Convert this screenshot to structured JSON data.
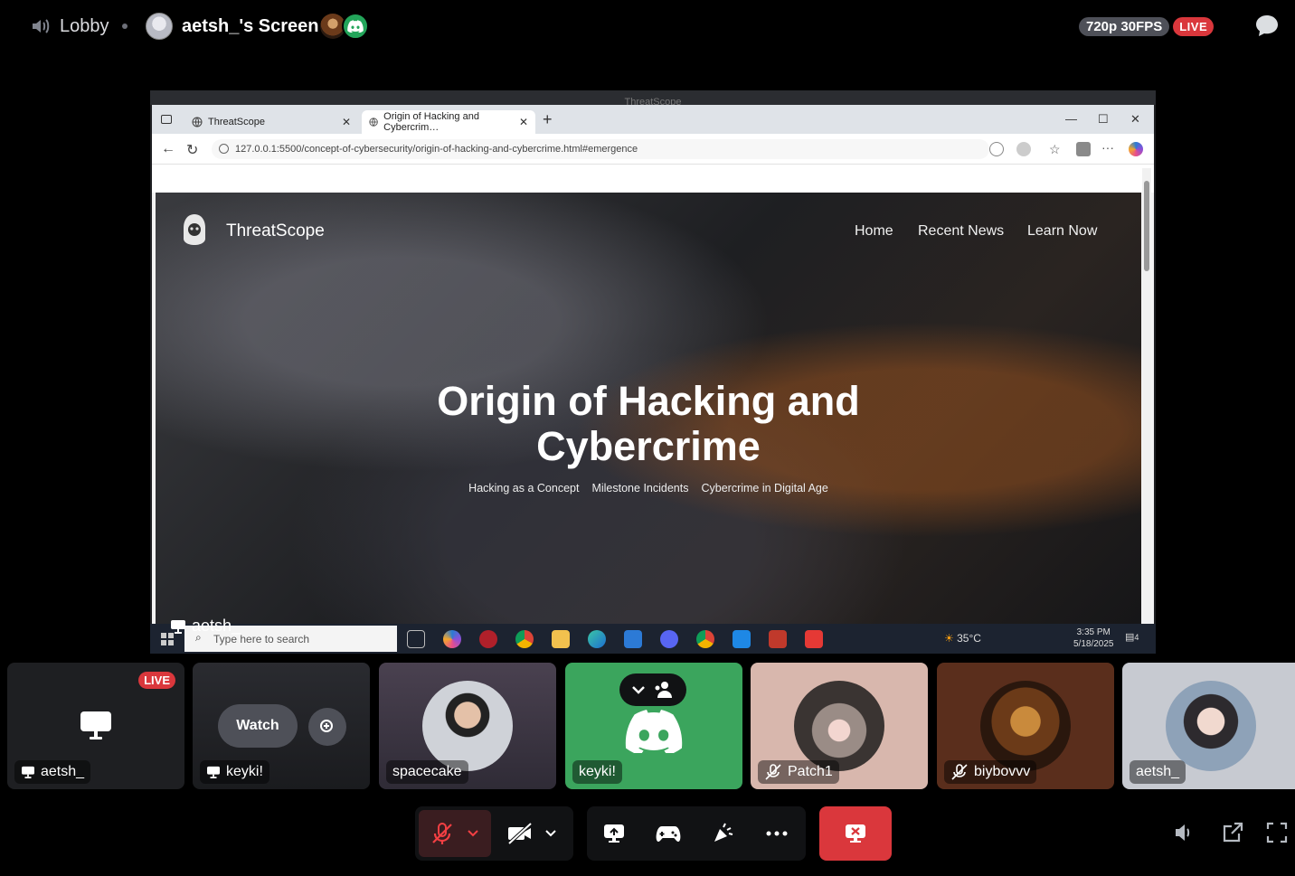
{
  "header": {
    "channel": "Lobby",
    "screen_title": "aetsh_'s Screen",
    "quality": "720p 30FPS",
    "live": "LIVE"
  },
  "stream": {
    "window_title": "ThreatScope",
    "owner": "aetsh_",
    "browser": {
      "tabs": [
        {
          "label": "ThreatScope"
        },
        {
          "label": "Origin of Hacking and Cybercrim…"
        }
      ],
      "url": "127.0.0.1:5500/concept-of-cybersecurity/origin-of-hacking-and-cybercrime.html#emergence"
    },
    "site": {
      "brand": "ThreatScope",
      "nav": [
        "Home",
        "Recent News",
        "Learn Now"
      ],
      "hero_title_line1": "Origin of Hacking and",
      "hero_title_line2": "Cybercrime",
      "hero_links": [
        "Hacking as a Concept",
        "Milestone Incidents",
        "Cybercrime in Digital Age"
      ]
    },
    "taskbar": {
      "search_placeholder": "Type here to search",
      "weather": "35°C",
      "time": "3:35 PM",
      "date": "5/18/2025",
      "notif_count": "4"
    }
  },
  "tiles": [
    {
      "name": "aetsh_",
      "badge": "LIVE"
    },
    {
      "name": "keyki!",
      "watch_label": "Watch"
    },
    {
      "name": "spacecake"
    },
    {
      "name": "keyki!"
    },
    {
      "name": "Patch1"
    },
    {
      "name": "biybovvv"
    },
    {
      "name": "aetsh_"
    }
  ],
  "colors": {
    "live_red": "#da373c",
    "discord_green": "#23a55a",
    "control_bg": "#111214"
  }
}
